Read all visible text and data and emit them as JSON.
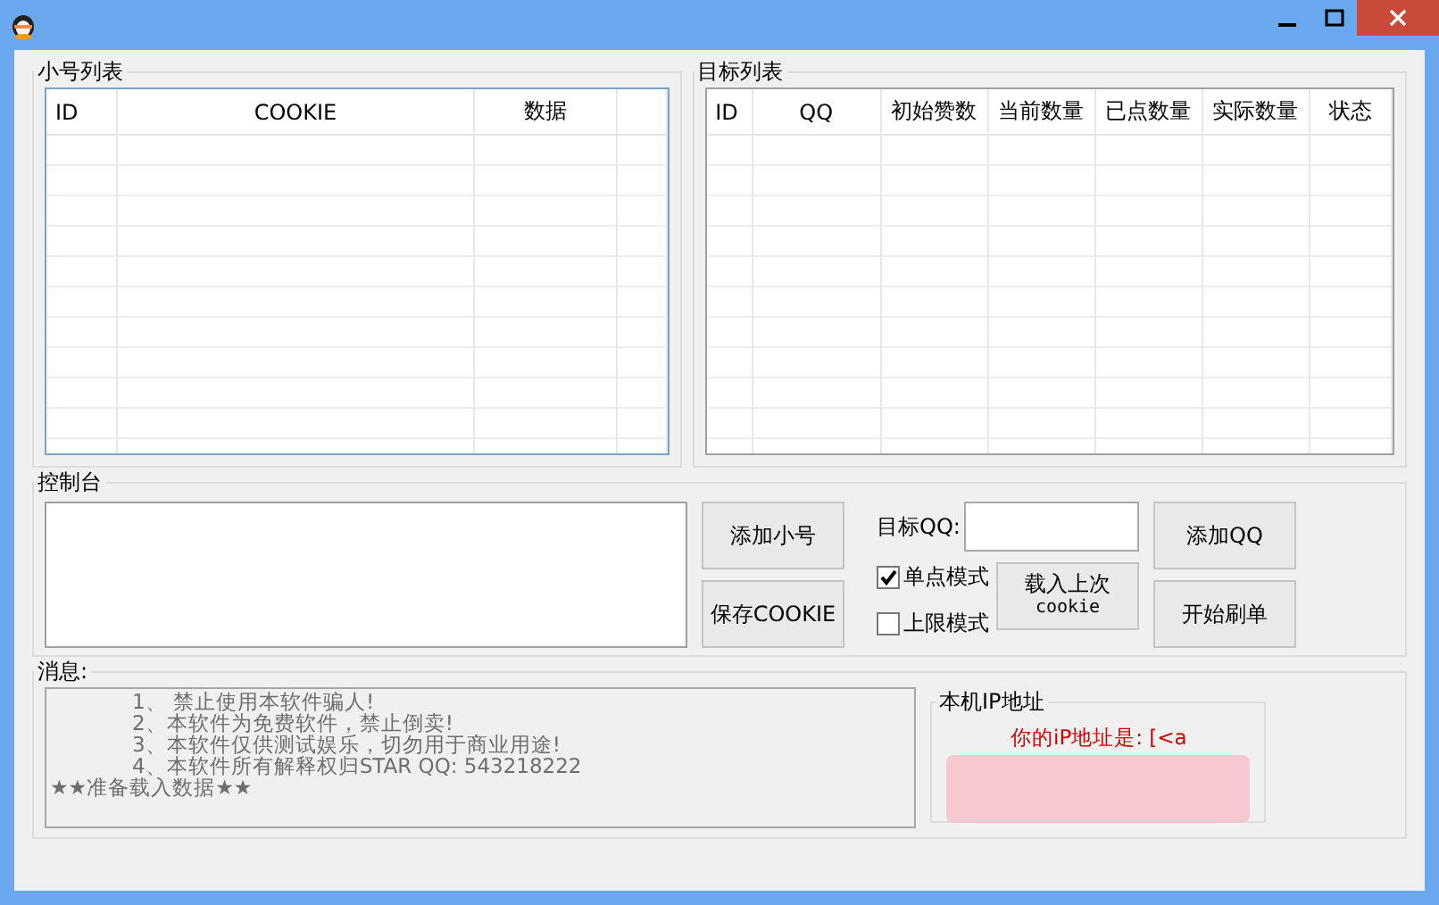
{
  "accounts_group": {
    "title": "小号列表",
    "columns": [
      "ID",
      "COOKIE",
      "数据"
    ]
  },
  "targets_group": {
    "title": "目标列表",
    "columns": [
      "ID",
      "QQ",
      "初始赞数",
      "当前数量",
      "已点数量",
      "实际数量",
      "状态"
    ]
  },
  "console_group": {
    "title": "控制台",
    "add_account_button": "添加小号",
    "save_cookie_button": "保存COOKIE",
    "target_qq": {
      "label": "目标QQ:"
    },
    "modes": [
      {
        "label": "单点模式",
        "checked": true
      },
      {
        "label": "上限模式",
        "checked": false
      }
    ],
    "load_last_button": {
      "line_1": "载入上次",
      "line_2": "cookie"
    },
    "add_qq_button": "添加QQ",
    "start_button": "开始刷单"
  },
  "messages_group": {
    "title": "消息:",
    "lines": [
      {
        "kind": "item",
        "text": "1、 禁止使用本软件骗人!"
      },
      {
        "kind": "item",
        "text": "2、本软件为免费软件，禁止倒卖!"
      },
      {
        "kind": "item",
        "text": "3、本软件仅供测试娱乐，切勿用于商业用途!"
      },
      {
        "kind": "item",
        "text": "4、本软件所有解释权归STAR QQ: 543218222"
      },
      {
        "kind": "status",
        "text": "★★准备载入数据★★"
      }
    ]
  },
  "ip_group": {
    "title": "本机IP地址",
    "text": "你的iP地址是: [<a"
  }
}
